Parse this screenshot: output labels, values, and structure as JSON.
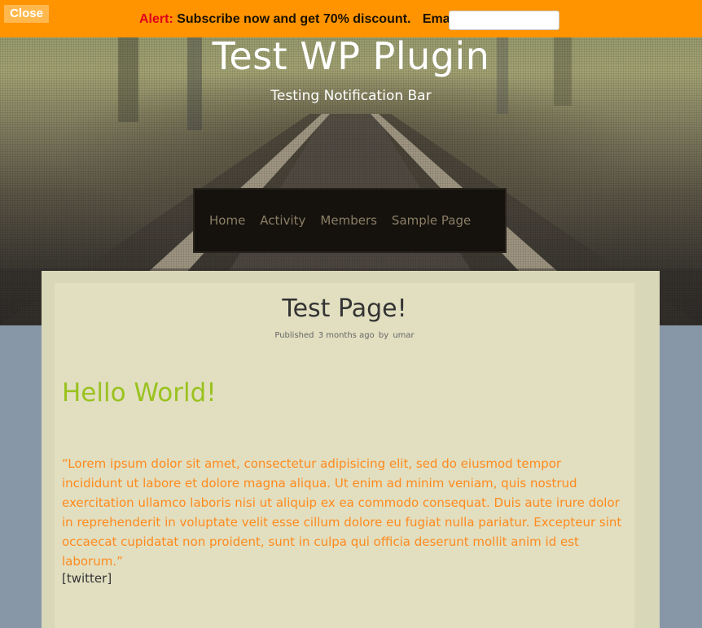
{
  "notification_bar": {
    "close_label": "Close",
    "alert_label": "Alert:",
    "message": "Subscribe now and get 70% discount.",
    "email_label": "Email :",
    "email_value": ""
  },
  "site": {
    "title": "Test WP Plugin",
    "description": "Testing Notification Bar"
  },
  "nav": {
    "items": [
      {
        "label": "Home"
      },
      {
        "label": "Activity"
      },
      {
        "label": "Members"
      },
      {
        "label": "Sample Page"
      }
    ]
  },
  "post": {
    "title": "Test Page!",
    "meta_published": "Published",
    "meta_time": "3 months ago",
    "meta_by": "by",
    "meta_author": "umar",
    "heading": "Hello World!",
    "quote": "“Lorem ipsum dolor sit amet, consectetur adipisicing elit, sed do eiusmod tempor incididunt ut labore et dolore magna aliqua. Ut enim ad minim veniam, quis nostrud exercitation ullamco laboris nisi ut aliquip ex ea commodo consequat. Duis aute irure dolor in reprehenderit in voluptate velit esse cillum dolore eu fugiat nulla pariatur. Excepteur sint occaecat cupidatat non proident, sunt in culpa qui officia deserunt mollit anim id est laborum.”",
    "shortcode": "[twitter]"
  },
  "colors": {
    "notification_bg": "#ff9400",
    "alert_text": "#e0001a",
    "heading_green": "#9ac21f",
    "quote_orange": "#ff8a1e",
    "nav_bg": "#15120d"
  }
}
